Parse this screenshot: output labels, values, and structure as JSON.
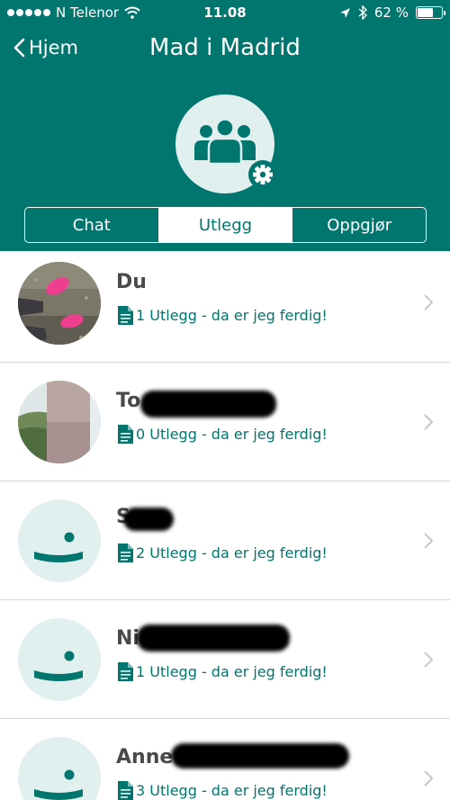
{
  "status_bar": {
    "carrier": "N Telenor",
    "time": "11.08",
    "battery": "62 %",
    "battery_level": 0.62
  },
  "nav": {
    "back_label": "Hjem",
    "title": "Mad i Madrid"
  },
  "tabs": [
    {
      "label": "Chat",
      "active": false
    },
    {
      "label": "Utlegg",
      "active": true
    },
    {
      "label": "Oppgjør",
      "active": false
    }
  ],
  "members": [
    {
      "name": "Du",
      "status": "1 Utlegg - da er jeg ferdig!",
      "avatar": "photo-pink-shoes"
    },
    {
      "name": "To",
      "status": "0 Utlegg - da er jeg ferdig!",
      "avatar": "photo-landscape"
    },
    {
      "name": "S",
      "status": "2 Utlegg - da er jeg ferdig!",
      "avatar": "default"
    },
    {
      "name": "Ni",
      "status": "1 Utlegg - da er jeg ferdig!",
      "avatar": "default"
    },
    {
      "name": "Anne",
      "status": "3 Utlegg - da er jeg ferdig!",
      "avatar": "default"
    }
  ],
  "icons": {
    "back": "chevron-left-icon",
    "group": "group-people-icon",
    "settings": "gear-icon",
    "document": "document-icon",
    "row_chevron": "chevron-right-icon"
  },
  "colors": {
    "brand": "#00766e",
    "avatar_bg": "#e1efee",
    "name_text": "#4a4a4a",
    "divider": "#d6d6d6",
    "chevron": "#c7c7cc"
  }
}
